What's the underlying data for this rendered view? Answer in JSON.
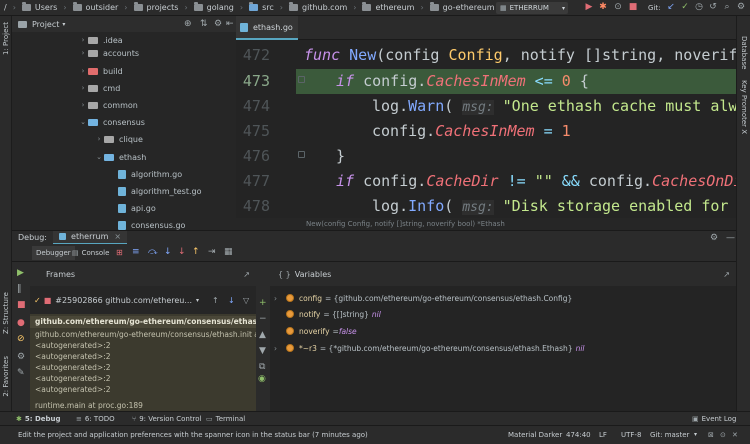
{
  "navbar": {
    "crumbs": [
      "/",
      "Users",
      "outsider",
      "projects",
      "golang",
      "src",
      "github.com",
      "ethereum",
      "go-ethereum"
    ],
    "run_config": "ETHERRUM",
    "git_label": "Git:"
  },
  "project": {
    "title": "Project",
    "tree": [
      {
        "label": ".idea",
        "type": "folder"
      },
      {
        "label": "accounts",
        "type": "folder"
      },
      {
        "label": "build",
        "type": "folder-red"
      },
      {
        "label": "cmd",
        "type": "folder"
      },
      {
        "label": "common",
        "type": "folder"
      },
      {
        "label": "consensus",
        "type": "folder-blue-open"
      },
      {
        "label": "clique",
        "type": "folder"
      },
      {
        "label": "ethash",
        "type": "folder-blue-open"
      },
      {
        "label": "algorithm.go",
        "type": "go"
      },
      {
        "label": "algorithm_test.go",
        "type": "go"
      },
      {
        "label": "api.go",
        "type": "go"
      },
      {
        "label": "consensus.go",
        "type": "go"
      }
    ]
  },
  "left_strip": {
    "project": "1: Project",
    "structure": "Z: Structure",
    "favorites": "2: Favorites"
  },
  "right_strip": {
    "database": "Database",
    "promoter": "Key Promoter X"
  },
  "editor": {
    "tab": "ethash.go",
    "lines": [
      "472",
      "473",
      "474",
      "475",
      "476",
      "477",
      "478"
    ],
    "code": {
      "l472_kw": "func ",
      "l472_fn": "New",
      "l472_p1": "(config ",
      "l472_t1": "Config",
      "l472_p2": ", notify []string, noverify b",
      "l473_kw": "if ",
      "l473_a": "config.",
      "l473_f": "CachesInMem",
      "l473_op": " <= ",
      "l473_n": "0",
      "l473_b": " {",
      "l474_a": "log.",
      "l474_fn": "Warn",
      "l474_p": "( ",
      "l474_hint": "msg:",
      "l474_s": " \"One ethash cache must always",
      "l475_a": "config.",
      "l475_f": "CachesInMem",
      "l475_op": " = ",
      "l475_n": "1",
      "l476": "}",
      "l477_kw": "if ",
      "l477_a": "config.",
      "l477_f": "CacheDir",
      "l477_op": " != ",
      "l477_s": "\"\"",
      "l477_and": " && ",
      "l477_b": "config.",
      "l477_f2": "CachesOnDisk",
      "l478_a": "log.",
      "l478_fn": "Info",
      "l478_p": "( ",
      "l478_hint": "msg:",
      "l478_s": " \"Disk storage enabled for eth"
    },
    "signature_hint": "New(config Config, notify []string, noverify bool) *Ethash"
  },
  "debug": {
    "title": "Debug:",
    "session": "etherrum",
    "tabs": [
      "Debugger",
      "Console"
    ],
    "frames_title": "Frames",
    "goroutine": "#25902866 github.com/ethereu...",
    "frames": [
      "github.com/ethereum/go-ethereum/consensus/ethash.New at",
      "github.com/ethereum/go-ethereum/consensus/ethash.init at e",
      "<autogenerated>:2",
      "<autogenerated>:2",
      "<autogenerated>:2",
      "<autogenerated>:2",
      "<autogenerated>:2",
      "runtime.main at proc.go:189"
    ],
    "variables_title": "Variables",
    "variables": [
      {
        "name": "config",
        "value": "= {github.com/ethereum/go-ethereum/consensus/ethash.Config}",
        "nil": "",
        "expand": true
      },
      {
        "name": "notify",
        "value": "= {[]string}",
        "nil": "nil",
        "expand": false
      },
      {
        "name": "noverify",
        "value": "= ",
        "nil": "false",
        "expand": false
      },
      {
        "name": "*~r3",
        "value": "= {*github.com/ethereum/go-ethereum/consensus/ethash.Ethash}",
        "nil": "nil",
        "expand": true
      }
    ]
  },
  "tool_tabs": [
    "5: Debug",
    "6: TODO",
    "9: Version Control",
    "Terminal"
  ],
  "event_log": "Event Log",
  "status": {
    "message": "Edit the project and application preferences with the spanner icon in the status bar (7 minutes ago)",
    "theme": "Material Darker",
    "position": "474:40",
    "line_sep": "LF",
    "encoding": "UTF-8",
    "git": "Git: master"
  }
}
